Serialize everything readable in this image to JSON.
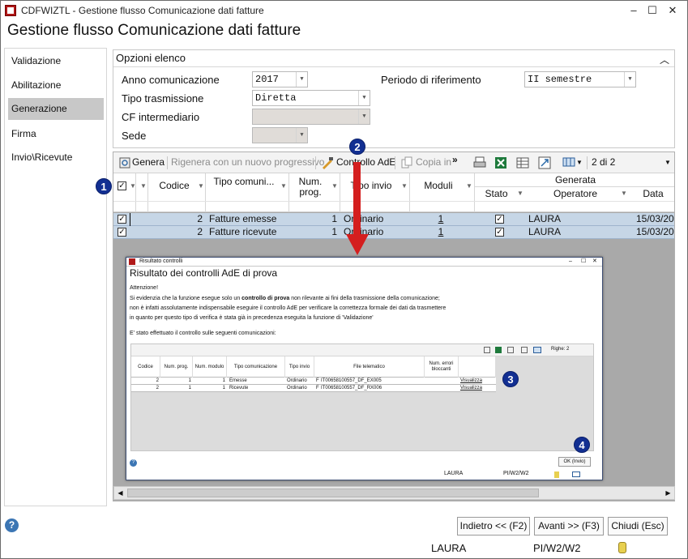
{
  "window": {
    "title": "CDFWIZTL - Gestione flusso Comunicazione dati fatture",
    "min": "–",
    "max": "☐",
    "close": "✕"
  },
  "heading": "Gestione flusso Comunicazione dati fatture",
  "sidebar": {
    "items": [
      {
        "label": "Validazione"
      },
      {
        "label": "Abilitazione"
      },
      {
        "label": "Generazione"
      },
      {
        "label": "Firma"
      },
      {
        "label": "Invio\\Ricevute"
      }
    ],
    "active": "Generazione"
  },
  "options": {
    "title": "Opzioni elenco",
    "anno_label": "Anno comunicazione",
    "anno_value": "2017",
    "periodo_label": "Periodo di riferimento",
    "periodo_value": "II semestre",
    "tipo_label": "Tipo trasmissione",
    "tipo_value": "Diretta",
    "cf_label": "CF intermediario",
    "cf_value": "",
    "sede_label": "Sede",
    "sede_value": ""
  },
  "toolbar": {
    "genera": "Genera",
    "rigenera": "Rigenera con un nuovo progressivo",
    "controllo": "Controllo AdE",
    "copia": "Copia in",
    "more": "»",
    "pager": "2 di 2"
  },
  "grid": {
    "headers": {
      "codice": "Codice",
      "tipo_com": "Tipo comuni...",
      "num_prog_1": "Num.",
      "num_prog_2": "prog.",
      "tipo_invio": "Tipo invio",
      "moduli": "Moduli",
      "generata": "Generata",
      "stato": "Stato",
      "operatore": "Operatore",
      "data": "Data"
    },
    "rows": [
      {
        "codice": "2",
        "tipo": "Fatture emesse",
        "prog": "1",
        "invio": "Ordinario",
        "moduli": "1",
        "operatore": "LAURA",
        "data": "15/03/20"
      },
      {
        "codice": "2",
        "tipo": "Fatture ricevute",
        "prog": "1",
        "invio": "Ordinario",
        "moduli": "1",
        "operatore": "LAURA",
        "data": "15/03/20"
      }
    ]
  },
  "popup": {
    "window_title": "Risultato controlli",
    "title": "Risultato dei controlli AdE di prova",
    "attenzione": "Attenzione!",
    "line1_a": "Si evidenzia che la funzione esegue solo un ",
    "line1_b": "controllo di prova",
    "line1_c": " non rilevante ai fini della trasmissione della comunicazione;",
    "line2": "non è infatti assolutamente indispensabile eseguire il controllo AdE per verificare la correttezza formale dei dati da trasmettere",
    "line3": "in quanto per questo tipo di verifica è stata già in precedenza eseguita la funzione di 'Validazione'",
    "line4": "E' stato effettuato il controllo sulle seguenti comunicazioni:",
    "righe": "Righe: 2",
    "headers": {
      "codice": "Codice",
      "num_prog": "Num. prog.",
      "num_mod": "Num. modulo",
      "tipo_com": "Tipo comunicazione",
      "tipo_invio": "Tipo invio",
      "file": "File telematico",
      "errori": "Num. errori bloccanti"
    },
    "rows": [
      {
        "codice": "2",
        "prog": "1",
        "mod": "1",
        "tipo": "Emesse",
        "invio": "Ordinario",
        "flag": "F",
        "file": "IT00658100557_DF_EX005",
        "link": "Visualizza"
      },
      {
        "codice": "2",
        "prog": "1",
        "mod": "1",
        "tipo": "Ricevute",
        "invio": "Ordinario",
        "flag": "F",
        "file": "IT00658100557_DF_RX006",
        "link": "Visualizza"
      }
    ],
    "ok": "OK (Invio)",
    "status_user": "LAURA",
    "status_path": "PI/W2/W2"
  },
  "badges": [
    "1",
    "2",
    "3",
    "4"
  ],
  "buttons": {
    "indietro": "Indietro << (F2)",
    "avanti": "Avanti >> (F3)",
    "chiudi": "Chiudi (Esc)"
  },
  "status": {
    "user": "LAURA",
    "path": "PI/W2/W2"
  },
  "colors": {
    "selection": "#c6d6e6",
    "accent_badge": "#122f92",
    "arrow": "#d41e1e"
  }
}
